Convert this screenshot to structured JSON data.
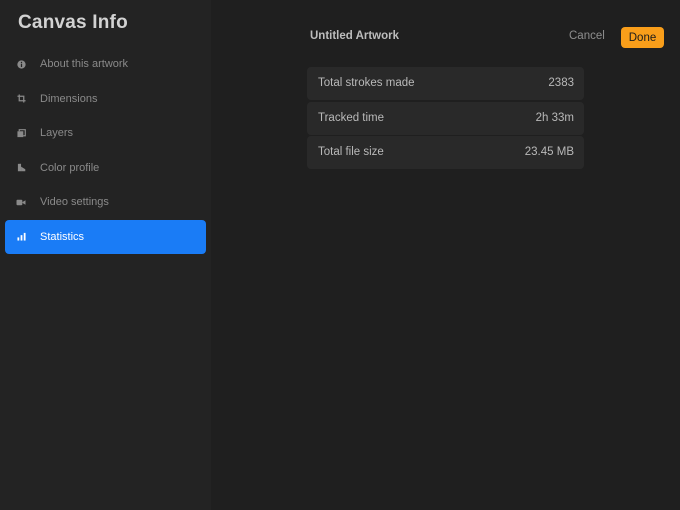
{
  "sidebar": {
    "title": "Canvas Info",
    "items": [
      {
        "label": "About this artwork",
        "icon": "info-icon"
      },
      {
        "label": "Dimensions",
        "icon": "crop-icon"
      },
      {
        "label": "Layers",
        "icon": "layers-icon"
      },
      {
        "label": "Color profile",
        "icon": "color-profile-icon"
      },
      {
        "label": "Video settings",
        "icon": "video-camera-icon"
      },
      {
        "label": "Statistics",
        "icon": "bar-chart-icon",
        "active": true
      }
    ]
  },
  "header": {
    "title": "Untitled Artwork",
    "cancel_label": "Cancel",
    "done_label": "Done"
  },
  "stats": [
    {
      "label": "Total strokes made",
      "value": "2383"
    },
    {
      "label": "Tracked time",
      "value": "2h 33m"
    },
    {
      "label": "Total file size",
      "value": "23.45 MB"
    }
  ],
  "colors": {
    "accent": "#1a7cf6",
    "done_button": "#f99e1a",
    "sidebar_bg": "#232323",
    "main_bg": "#1f1f1f",
    "row_bg": "#292929"
  }
}
